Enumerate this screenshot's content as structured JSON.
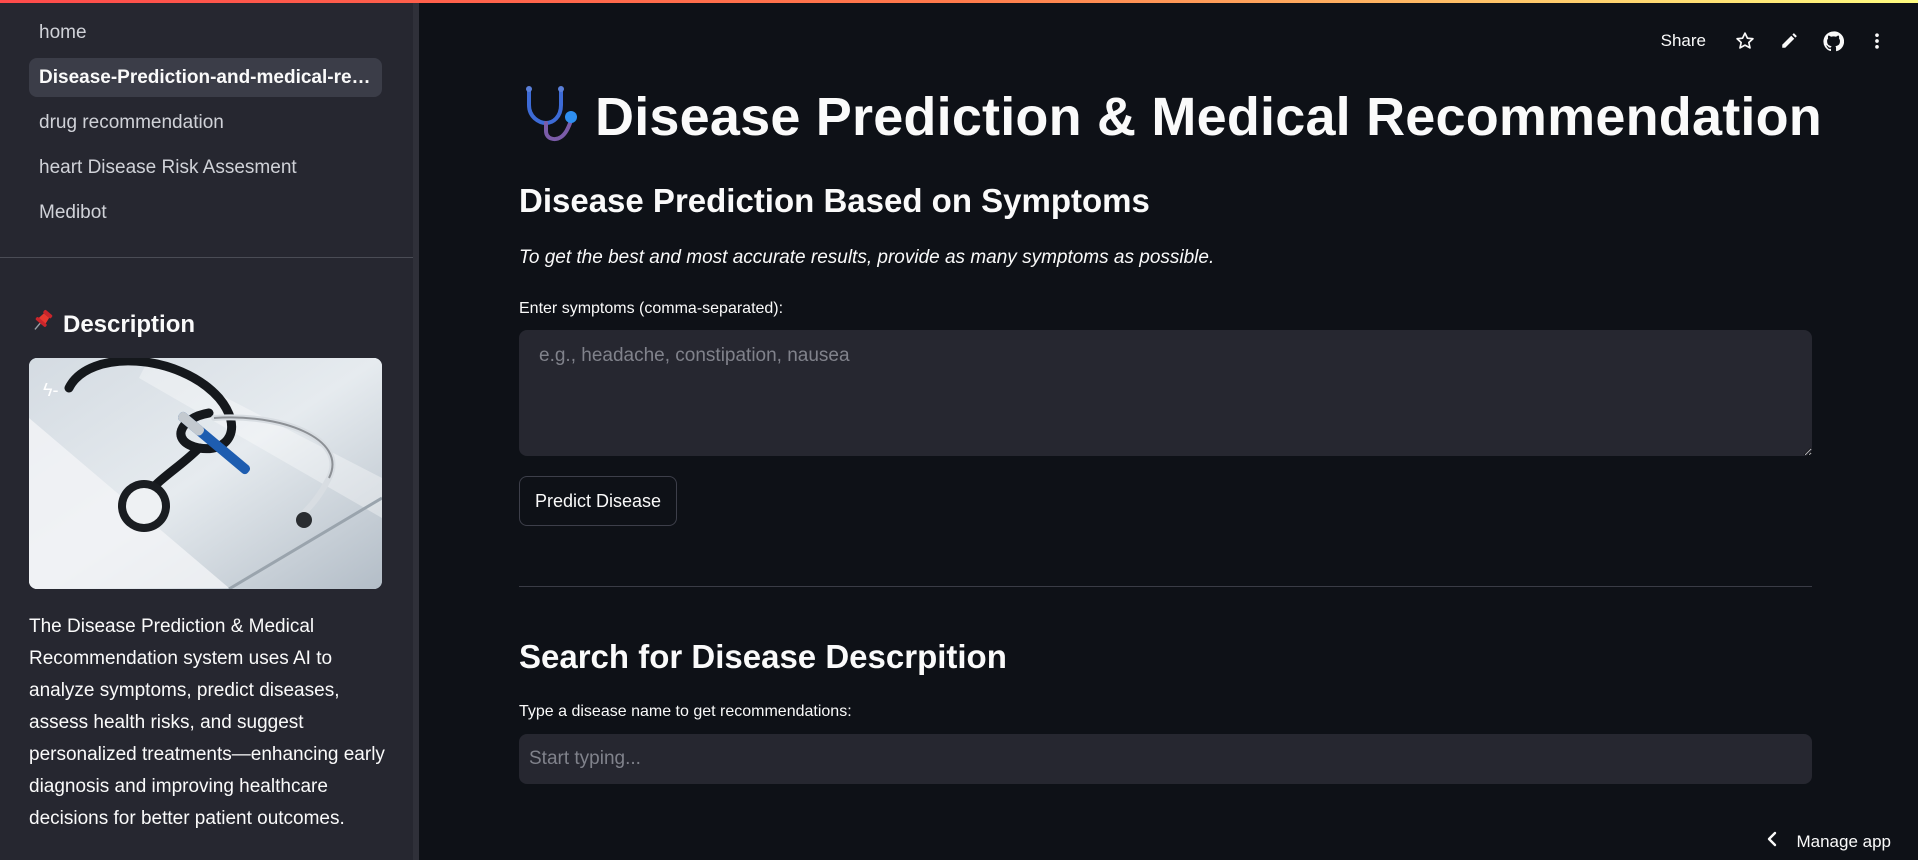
{
  "sidebar": {
    "nav": [
      {
        "label": "home",
        "active": false
      },
      {
        "label": "Disease-Prediction-and-medical-recommendation",
        "active": true
      },
      {
        "label": "drug recommendation",
        "active": false
      },
      {
        "label": "heart Disease Risk Assesment",
        "active": false
      },
      {
        "label": "Medibot",
        "active": false
      }
    ],
    "description_heading": "Description",
    "description_icon": "pushpin-icon",
    "description_text": "The Disease Prediction & Medical Recommendation system uses AI to analyze symptoms, predict diseases, assess health risks, and suggest personalized treatments—enhancing early diagnosis and improving healthcare decisions for better patient outcomes.",
    "image_subject": "stethoscope-and-pen-on-clipboard"
  },
  "toolbar": {
    "share_label": "Share",
    "icons": [
      "star-icon",
      "pencil-icon",
      "github-icon",
      "more-vertical-icon"
    ]
  },
  "main": {
    "title": "Disease Prediction & Medical Recommendation",
    "title_icon": "stethoscope-icon",
    "section1_heading": "Disease Prediction Based on Symptoms",
    "section1_hint": "To get the best and most accurate results, provide as many symptoms as possible.",
    "symptoms_label": "Enter symptoms (comma-separated):",
    "symptoms_placeholder": "e.g., headache, constipation, nausea",
    "symptoms_value": "",
    "predict_button": "Predict Disease",
    "section2_heading": "Search for Disease Descrpition",
    "search_label": "Type a disease name to get recommendations:",
    "search_placeholder": "Start typing...",
    "search_value": ""
  },
  "footer": {
    "manage_label": "Manage app"
  },
  "colors": {
    "background": "#0e1117",
    "sidebar": "#262730",
    "accent_gradient_start": "#ff4b4b",
    "accent_gradient_end": "#fffd80",
    "text": "#fafafa"
  }
}
